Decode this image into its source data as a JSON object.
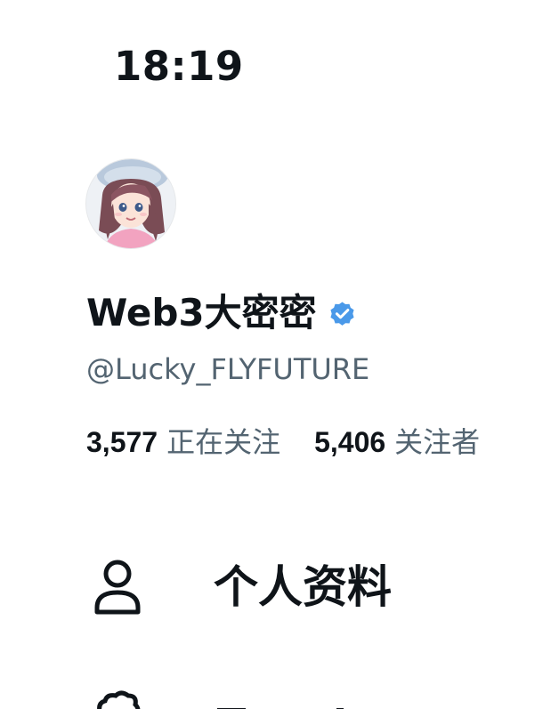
{
  "status_bar": {
    "time": "18:19"
  },
  "profile": {
    "avatar_icon": "avatar-illustration",
    "display_name": "Web3大密密",
    "verified_icon": "verified-badge-icon",
    "verified_color": "#4a99e9",
    "handle": "@Lucky_FLYFUTURE",
    "following_count": "3,577",
    "following_label": "正在关注",
    "followers_count": "5,406",
    "followers_label": "关注者"
  },
  "menu": {
    "items": [
      {
        "icon": "person-icon",
        "label": "个人资料"
      },
      {
        "icon": "topics-icon",
        "label": ""
      }
    ]
  },
  "colors": {
    "text_primary": "#0f1419",
    "text_secondary": "#536471",
    "background": "#ffffff"
  }
}
